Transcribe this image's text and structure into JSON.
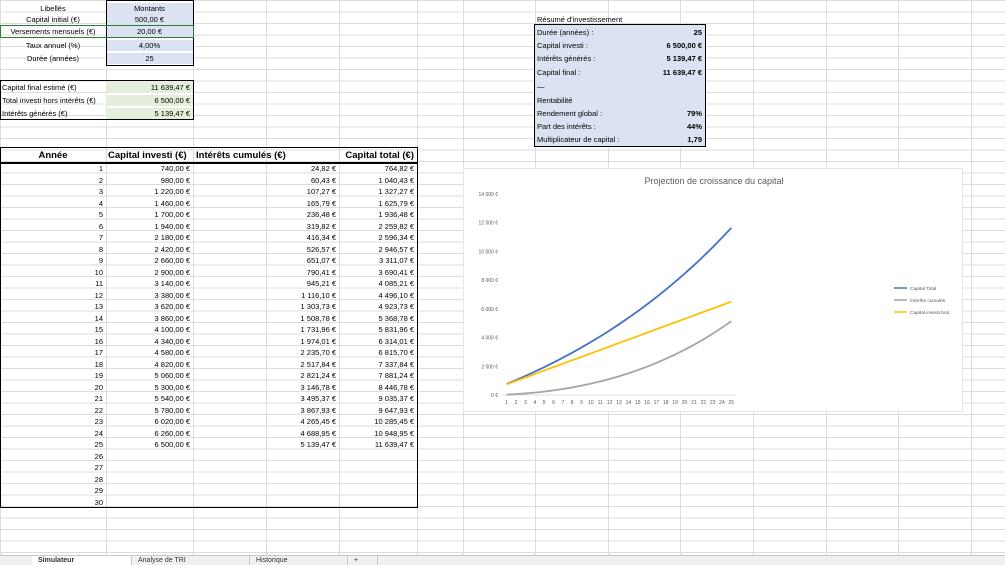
{
  "inputs": {
    "header_label": "Libellés",
    "header_amount": "Montants",
    "rows": [
      {
        "label": "Capital initial (€)",
        "value": "500,00 €"
      },
      {
        "label": "Versements mensuels (€)",
        "value": "20,00 €"
      },
      {
        "label": "Taux annuel (%)",
        "value": "4,00%"
      },
      {
        "label": "Durée (années)",
        "value": "25"
      }
    ]
  },
  "results": [
    {
      "label": "Capital final estimé (€)",
      "value": "11 639,47 €"
    },
    {
      "label": "Total investi hors intérêts (€)",
      "value": "6 500,00 €"
    },
    {
      "label": "Intérêts générés (€)",
      "value": "5 139,47 €"
    }
  ],
  "summary": {
    "title": "Résumé d'investissement",
    "rows": [
      {
        "label": "Durée (années) :",
        "value": "25"
      },
      {
        "label": "Capital investi :",
        "value": "6 500,00 €"
      },
      {
        "label": "Intérêts générés :",
        "value": "5 139,47 €"
      },
      {
        "label": "Capital final :",
        "value": "11 639,47 €"
      },
      {
        "label": "—",
        "value": ""
      },
      {
        "label": "Rentabilité",
        "value": ""
      },
      {
        "label": "Rendement global :",
        "value": "79%"
      },
      {
        "label": "Part des intérêts :",
        "value": "44%"
      },
      {
        "label": "Multiplicateur de capital :",
        "value": "1,79"
      }
    ]
  },
  "table": {
    "headers": [
      "Année",
      "Capital investi (€)",
      "Intérêts cumulés (€)",
      "Capital total (€)"
    ],
    "rows": [
      [
        "1",
        "740,00 €",
        "24,82 €",
        "764,82 €"
      ],
      [
        "2",
        "980,00 €",
        "60,43 €",
        "1 040,43 €"
      ],
      [
        "3",
        "1 220,00 €",
        "107,27 €",
        "1 327,27 €"
      ],
      [
        "4",
        "1 460,00 €",
        "165,79 €",
        "1 625,79 €"
      ],
      [
        "5",
        "1 700,00 €",
        "236,48 €",
        "1 936,48 €"
      ],
      [
        "6",
        "1 940,00 €",
        "319,82 €",
        "2 259,82 €"
      ],
      [
        "7",
        "2 180,00 €",
        "416,34 €",
        "2 596,34 €"
      ],
      [
        "8",
        "2 420,00 €",
        "526,57 €",
        "2 946,57 €"
      ],
      [
        "9",
        "2 660,00 €",
        "651,07 €",
        "3 311,07 €"
      ],
      [
        "10",
        "2 900,00 €",
        "790,41 €",
        "3 690,41 €"
      ],
      [
        "11",
        "3 140,00 €",
        "945,21 €",
        "4 085,21 €"
      ],
      [
        "12",
        "3 380,00 €",
        "1 116,10 €",
        "4 496,10 €"
      ],
      [
        "13",
        "3 620,00 €",
        "1 303,73 €",
        "4 923,73 €"
      ],
      [
        "14",
        "3 860,00 €",
        "1 508,78 €",
        "5 368,78 €"
      ],
      [
        "15",
        "4 100,00 €",
        "1 731,96 €",
        "5 831,96 €"
      ],
      [
        "16",
        "4 340,00 €",
        "1 974,01 €",
        "6 314,01 €"
      ],
      [
        "17",
        "4 580,00 €",
        "2 235,70 €",
        "6 815,70 €"
      ],
      [
        "18",
        "4 820,00 €",
        "2 517,84 €",
        "7 337,84 €"
      ],
      [
        "19",
        "5 060,00 €",
        "2 821,24 €",
        "7 881,24 €"
      ],
      [
        "20",
        "5 300,00 €",
        "3 146,78 €",
        "8 446,78 €"
      ],
      [
        "21",
        "5 540,00 €",
        "3 495,37 €",
        "9 035,37 €"
      ],
      [
        "22",
        "5 780,00 €",
        "3 867,93 €",
        "9 647,93 €"
      ],
      [
        "23",
        "6 020,00 €",
        "4 265,45 €",
        "10 285,45 €"
      ],
      [
        "24",
        "6 260,00 €",
        "4 688,95 €",
        "10 948,95 €"
      ],
      [
        "25",
        "6 500,00 €",
        "5 139,47 €",
        "11 639,47 €"
      ],
      [
        "26",
        "",
        "",
        ""
      ],
      [
        "27",
        "",
        "",
        ""
      ],
      [
        "28",
        "",
        "",
        ""
      ],
      [
        "29",
        "",
        "",
        ""
      ],
      [
        "30",
        "",
        "",
        ""
      ]
    ]
  },
  "chart_data": {
    "type": "line",
    "title": "Projection de croissance du capital",
    "categories": [
      1,
      2,
      3,
      4,
      5,
      6,
      7,
      8,
      9,
      10,
      11,
      12,
      13,
      14,
      15,
      16,
      17,
      18,
      19,
      20,
      21,
      22,
      23,
      24,
      25
    ],
    "y_ticks": [
      "0 €",
      "2 000 €",
      "4 000 €",
      "6 000 €",
      "8 000 €",
      "10 000 €",
      "12 000 €",
      "14 000 €"
    ],
    "ylim": [
      0,
      14000
    ],
    "legend_position": "right",
    "series": [
      {
        "name": "Capital Total",
        "color": "#4472c4",
        "values": [
          764.82,
          1040.43,
          1327.27,
          1625.79,
          1936.48,
          2259.82,
          2596.34,
          2946.57,
          3311.07,
          3690.41,
          4085.21,
          4496.1,
          4923.73,
          5368.78,
          5831.96,
          6314.01,
          6815.7,
          7337.84,
          7881.24,
          8446.78,
          9035.37,
          9647.93,
          10285.45,
          10948.95,
          11639.47
        ]
      },
      {
        "name": "Intérêts cumulés",
        "color": "#a5a5a5",
        "values": [
          24.82,
          60.43,
          107.27,
          165.79,
          236.48,
          319.82,
          416.34,
          526.57,
          651.07,
          790.41,
          945.21,
          1116.1,
          1303.73,
          1508.78,
          1731.96,
          1974.01,
          2235.7,
          2517.84,
          2821.24,
          3146.78,
          3495.37,
          3867.93,
          4265.45,
          4688.95,
          5139.47
        ]
      },
      {
        "name": "Capital investi brut",
        "color": "#ffc000",
        "values": [
          740,
          980,
          1220,
          1460,
          1700,
          1940,
          2180,
          2420,
          2660,
          2900,
          3140,
          3380,
          3620,
          3860,
          4100,
          4340,
          4580,
          4820,
          5060,
          5300,
          5540,
          5780,
          6020,
          6260,
          6500
        ]
      }
    ]
  },
  "tabs": [
    "Simulateur",
    "Analyse de TRI",
    "Historique",
    "+"
  ]
}
